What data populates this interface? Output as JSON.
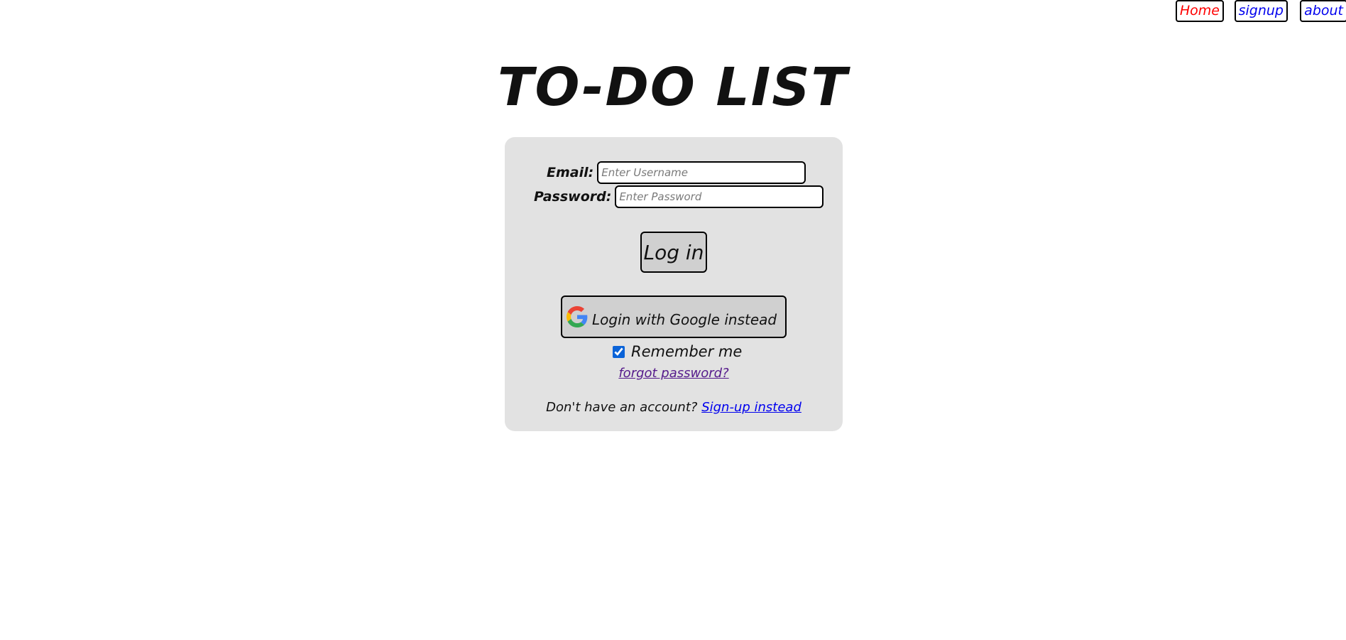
{
  "nav": {
    "home": "Home",
    "signup": "signup",
    "about": "about",
    "home_color": "#ff0000",
    "link_color": "#0000ee"
  },
  "title": "TO-DO LIST",
  "form": {
    "email_label": "Email:",
    "email_placeholder": "Enter Username",
    "email_value": "",
    "password_label": "Password:",
    "password_placeholder": "Enter Password",
    "password_value": "",
    "login_label": "Log in",
    "google_label": "Login with Google instead",
    "google_icon": "google-g-icon",
    "remember_label": "Remember me",
    "remember_checked": true,
    "forgot_label": "forgot password?",
    "no_account_text": "Don't have an account?",
    "signup_link": "Sign-up instead"
  },
  "colors": {
    "card_bg": "#e2e2e2",
    "button_bg": "#d0d0d0",
    "visited_link": "#551a8b"
  }
}
